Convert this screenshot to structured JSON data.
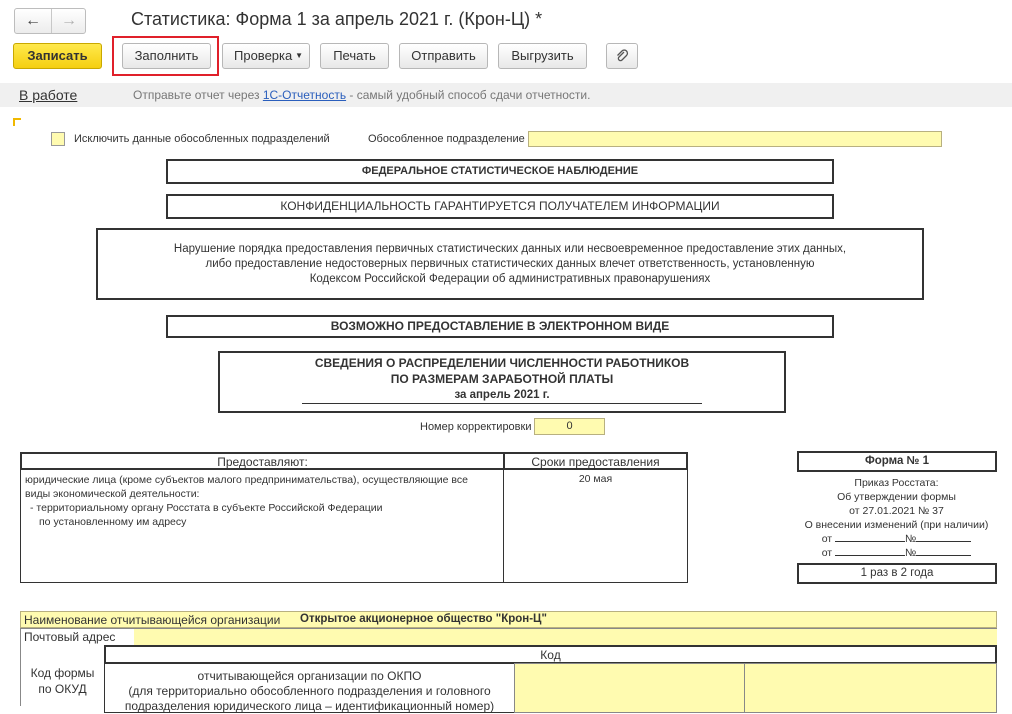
{
  "nav": {
    "back_icon": "arrow-left",
    "forward_icon": "arrow-right"
  },
  "window": {
    "title": "Статистика: Форма 1 за апрель 2021 г. (Крон-Ц) *"
  },
  "toolbar": {
    "save": "Записать",
    "fill": "Заполнить",
    "check": "Проверка",
    "print": "Печать",
    "send": "Отправить",
    "export": "Выгрузить",
    "attach_icon": "paperclip-icon"
  },
  "status": {
    "state": "В работе",
    "msg_prefix": "Отправьте отчет через ",
    "msg_link": "1С-Отчетность",
    "msg_suffix": " - самый удобный способ сдачи отчетности."
  },
  "form": {
    "exclude_label": "Исключить данные обособленных подразделений",
    "subdivision_label": "Обособленное подразделение",
    "subdivision_value": "",
    "federal": "ФЕДЕРАЛЬНОЕ СТАТИСТИЧЕСКОЕ НАБЛЮДЕНИЕ",
    "confidential": "КОНФИДЕНЦИАЛЬНОСТЬ ГАРАНТИРУЕТСЯ ПОЛУЧАТЕЛЕМ ИНФОРМАЦИИ",
    "warning_1": "Нарушение порядка предоставления первичных статистических данных или несвоевременное предоставление этих данных,",
    "warning_2": "либо предоставление недостоверных первичных статистических данных влечет ответственность, установленную",
    "warning_3": "Кодексом Российской Федерации об административных правонарушениях",
    "electronic": "ВОЗМОЖНО ПРЕДОСТАВЛЕНИЕ В ЭЛЕКТРОННОМ ВИДЕ",
    "report_title_1": "СВЕДЕНИЯ О РАСПРЕДЕЛЕНИИ ЧИСЛЕННОСТИ РАБОТНИКОВ",
    "report_title_2": "ПО РАЗМЕРАМ ЗАРАБОТНОЙ ПЛАТЫ",
    "report_period": "за апрель 2021 г.",
    "correction_label": "Номер корректировки",
    "correction_value": "0",
    "submit_header": "Предоставляют:",
    "deadline_header": "Сроки предоставления",
    "submit_text_1": "юридические лица (кроме субъектов малого предпринимательства), осуществляющие все",
    "submit_text_2": "виды экономической деятельности:",
    "submit_text_3": "- территориальному органу Росстата в субъекте Российской Федерации",
    "submit_text_4": "по установленному им адресу",
    "deadline_value": "20 мая",
    "form_no": "Форма № 1",
    "order_1": "Приказ Росстата:",
    "order_2": "Об утверждении формы",
    "order_3": "от 27.01.2021 № 37",
    "order_4": "О внесении изменений (при наличии)",
    "order_from_1": "от",
    "order_no_1": "№",
    "order_from_2": "от",
    "order_no_2": "№",
    "frequency": "1 раз в 2 года",
    "org_label": "Наименование отчитывающейся организации",
    "org_value": "Открытое акционерное общество \"Крон-Ц\"",
    "address_label": "Почтовый адрес",
    "address_value": "",
    "code_header": "Код",
    "okud_label_1": "Код формы",
    "okud_label_2": "по ОКУД",
    "okpo_1": "отчитывающейся организации по ОКПО",
    "okpo_2": "(для территориально обособленного подразделения и головного",
    "okpo_3": "подразделения юридического лица – идентификационный номер)"
  },
  "colors": {
    "accent_yellow": "#f5cf10",
    "field_yellow": "#fffbb0",
    "highlight_red": "#e0202a",
    "link_blue": "#2a5ebc"
  }
}
